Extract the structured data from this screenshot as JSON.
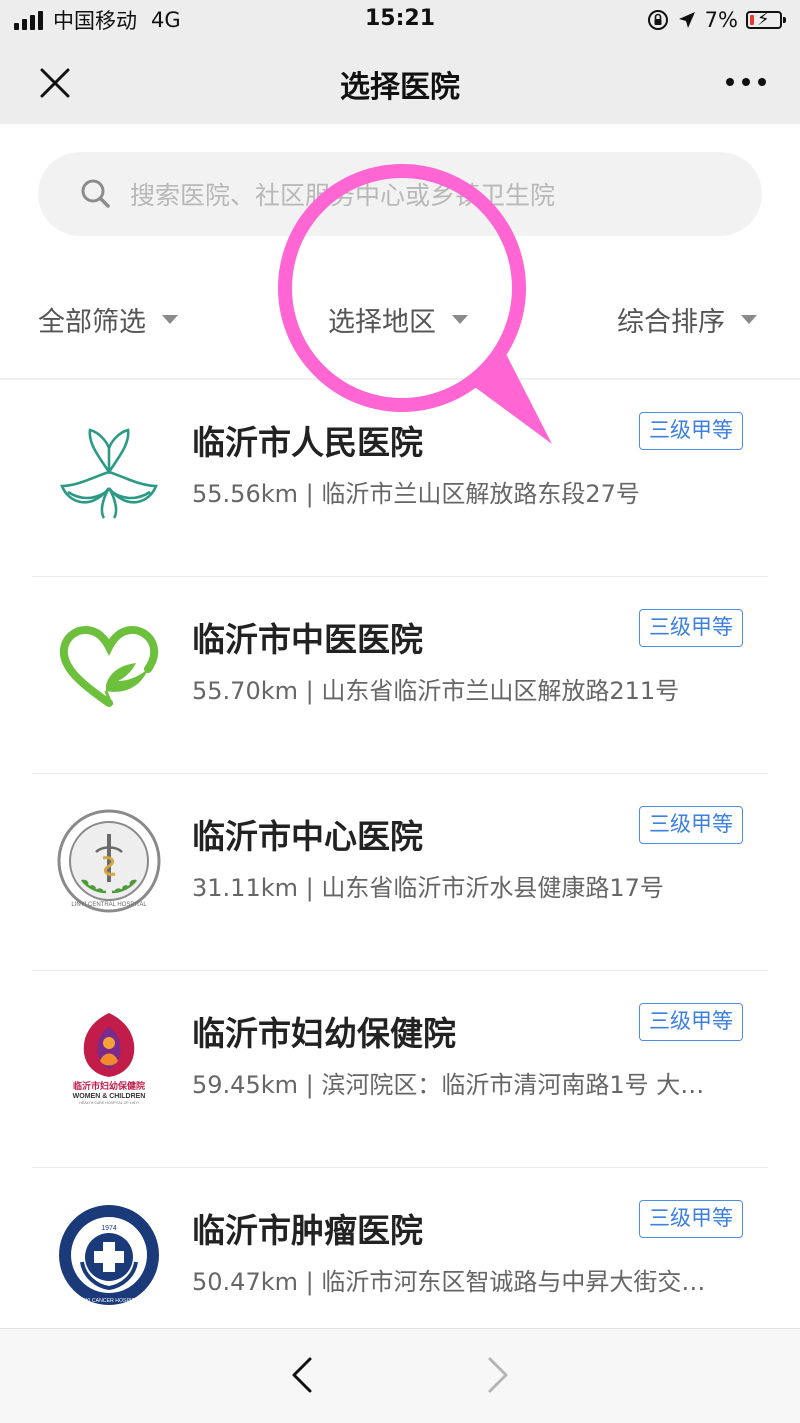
{
  "status_bar": {
    "carrier": "中国移动",
    "network": "4G",
    "time": "15:21",
    "battery_percent": "7%",
    "icons": [
      "signal-icon",
      "orientation-lock-icon",
      "location-arrow-icon",
      "battery-charging-icon"
    ]
  },
  "nav": {
    "title": "选择医院",
    "close_icon": "close-icon",
    "more_icon": "more-icon"
  },
  "search": {
    "placeholder": "搜索医院、社区服务中心或乡镇卫生院",
    "icon": "search-icon"
  },
  "filters": [
    {
      "label": "全部筛选"
    },
    {
      "label": "选择地区"
    },
    {
      "label": "综合排序"
    }
  ],
  "hospitals": [
    {
      "name": "临沂市人民医院",
      "info": "55.56km | 临沂市兰山区解放路东段27号",
      "level": "三级甲等"
    },
    {
      "name": "临沂市中医医院",
      "info": "55.70km | 山东省临沂市兰山区解放路211号",
      "level": "三级甲等"
    },
    {
      "name": "临沂市中心医院",
      "info": "31.11km | 山东省临沂市沂水县健康路17号",
      "level": "三级甲等"
    },
    {
      "name": "临沂市妇幼保健院",
      "info": "59.45km | 滨河院区：临沂市清河南路1号 大…",
      "level": "三级甲等"
    },
    {
      "name": "临沂市肿瘤医院",
      "info": "50.47km | 临沂市河东区智诚路与中昇大街交…",
      "level": "三级甲等"
    }
  ],
  "logos": {
    "central_text": "LINYI CENTRAL HOSPITAL",
    "maternal_cn": "临沂市妇幼保健院",
    "maternal_en": "WOMEN & CHILDREN",
    "maternal_sub": "HEALTH CARE HOSPITAL OF LINYI",
    "cancer_year": "1974",
    "cancer_text": "LINYI CANCER HOSPITAL"
  },
  "colors": {
    "badge_blue": "#3c80e0",
    "magnifier_pink": "#ff66d4",
    "header_bg": "#ededed"
  },
  "bottom_bar": {
    "back_icon": "chevron-left-icon",
    "forward_icon": "chevron-right-icon"
  }
}
